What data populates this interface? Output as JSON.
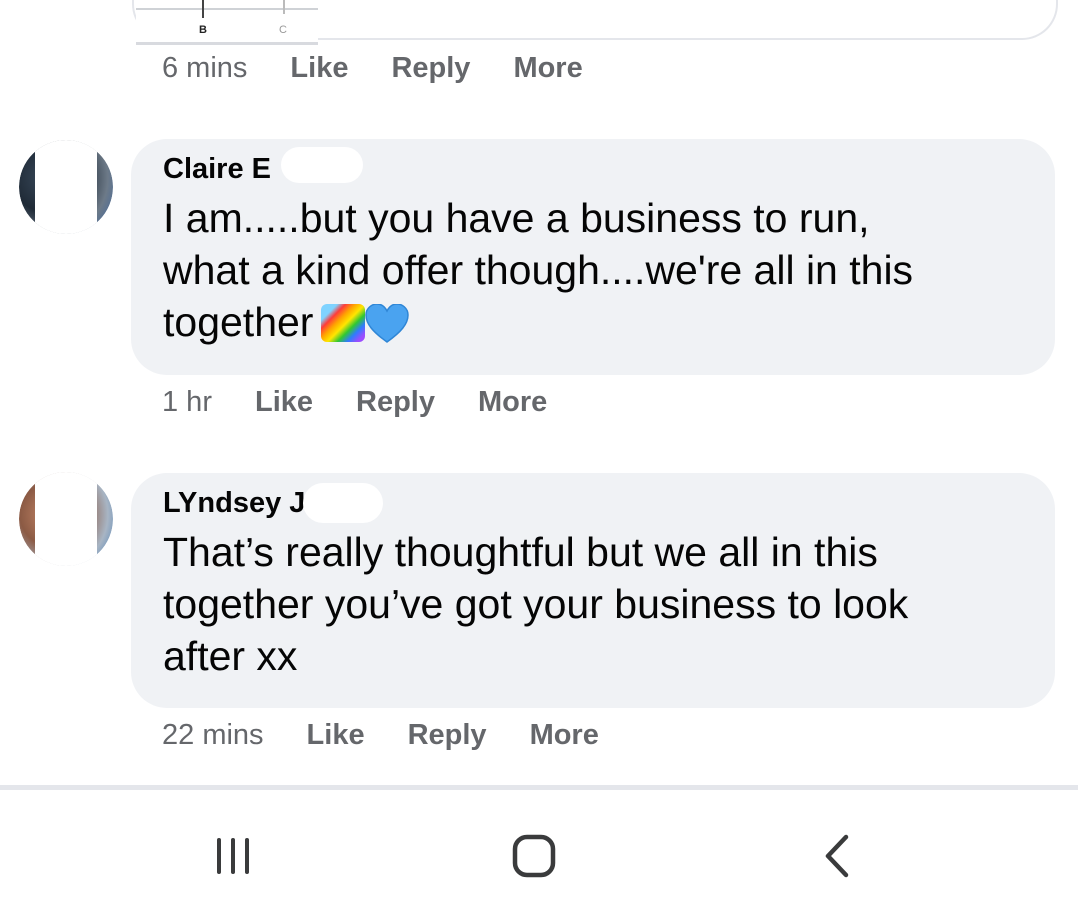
{
  "previous_comment": {
    "image_labels": [
      "B",
      "C"
    ],
    "time": "6 mins",
    "like": "Like",
    "reply": "Reply",
    "more": "More"
  },
  "comments": [
    {
      "author": "Claire E",
      "text": "I am.....but you have a business to run,\nwhat a kind offer though....we're all in this\ntogether",
      "emojis": [
        "rainbow-emoji",
        "blue-heart-emoji"
      ],
      "time": "1 hr",
      "like": "Like",
      "reply": "Reply",
      "more": "More"
    },
    {
      "author": "LYndsey J",
      "text": "That’s really thoughtful but we all in this\ntogether you’ve got your business to look\nafter xx",
      "time": "22 mins",
      "like": "Like",
      "reply": "Reply",
      "more": "More"
    }
  ],
  "navbar": {
    "recents": "recent-apps-icon",
    "home": "home-icon",
    "back": "back-icon"
  },
  "colors": {
    "bubble": "#f0f2f5",
    "meta_text": "#65676b",
    "text": "#050505"
  }
}
